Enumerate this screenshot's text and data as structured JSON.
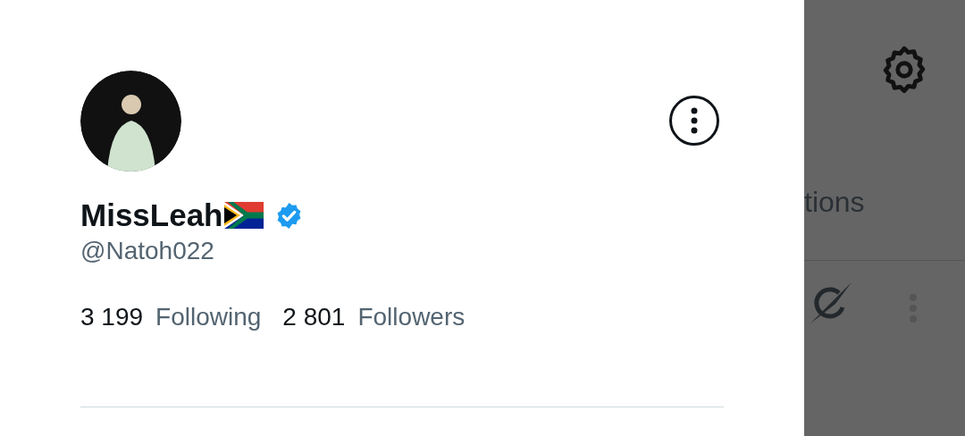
{
  "profile": {
    "name": "MissLeah",
    "flag": true,
    "verified": true,
    "handle": "@Natoh022",
    "stats": [
      {
        "count": "3 199",
        "label": "Following"
      },
      {
        "count": "2 801",
        "label": "Followers"
      }
    ]
  },
  "background": {
    "tab_label": "tions"
  }
}
